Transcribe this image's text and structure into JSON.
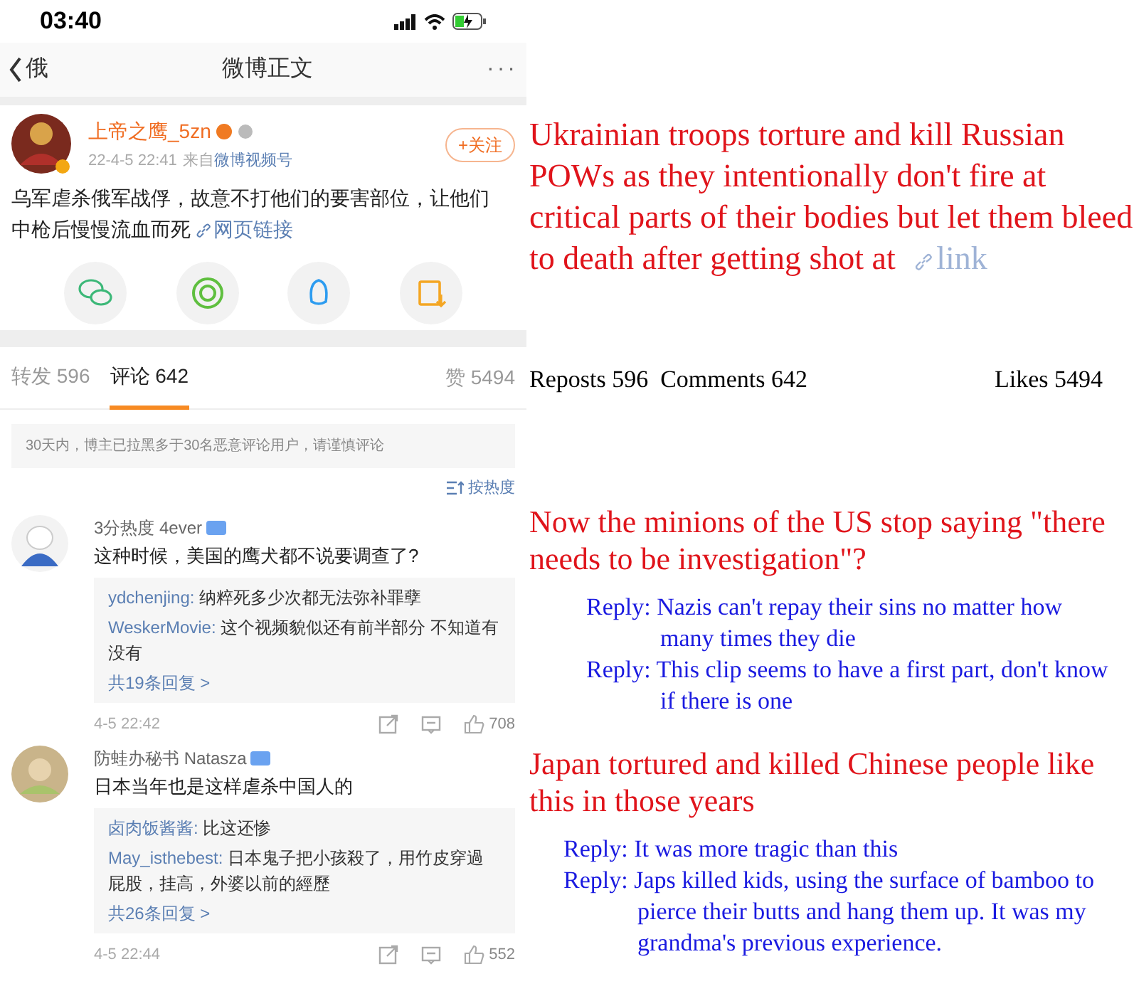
{
  "status_bar": {
    "time": "03:40"
  },
  "nav": {
    "back_label": "俄",
    "title": "微博正文",
    "more": "···"
  },
  "post": {
    "author": "上帝之鹰_5zn",
    "time": "22-4-5 22:41",
    "source_prefix": "来自",
    "source": "微博视频号",
    "follow": "+关注",
    "text": "乌军虐杀俄军战俘，故意不打他们的要害部位，让他们中枪后慢慢流血而死",
    "link": "网页链接"
  },
  "share_buttons": [
    {
      "kind": "wechat"
    },
    {
      "kind": "moments"
    },
    {
      "kind": "qq"
    },
    {
      "kind": "save_image"
    }
  ],
  "tabs": [
    {
      "label": "转发 596",
      "selected": false
    },
    {
      "label": "评论 642",
      "selected": true
    }
  ],
  "likes": "赞 5494",
  "notice": "30天内，博主已拉黑多于30名恶意评论用户，请谨慎评论",
  "sort": "按热度",
  "comments": [
    {
      "author": "3分热度 4ever",
      "text": "这种时候，美国的鹰犬都不说要调查了?",
      "replies": [
        {
          "author": "ydchenjing:",
          "text": "纳粹死多少次都无法弥补罪孽"
        },
        {
          "author": "WeskerMovie:",
          "text": "这个视频貌似还有前半部分 不知道有没有"
        }
      ],
      "more_replies": "共19条回复 >",
      "time": "4-5 22:42",
      "likes": "708"
    },
    {
      "author": "防蛙办秘书 Natasza",
      "text": "日本当年也是这样虐杀中国人的",
      "replies": [
        {
          "author": "卤肉饭酱酱:",
          "text": "比这还惨"
        },
        {
          "author": "May_isthebest:",
          "text": "日本鬼子把小孩殺了，用竹皮穿過屁股，挂高，外婆以前的經歷"
        }
      ],
      "more_replies": "共26条回复 >",
      "time": "4-5 22:44",
      "likes": "552"
    }
  ],
  "translation": {
    "post_text": "Ukrainian troops torture and kill Russian POWs as they intentionally don't fire at critical parts of their bodies but let them bleed to death after getting shot at",
    "link": "link",
    "stats": "Reposts 596  Comments 642",
    "likes": "Likes 5494",
    "comments": [
      {
        "text": "Now the minions of the US stop saying \"there needs to be investigation\"?",
        "replies": [
          "Reply: Nazis can't repay their sins no matter how many times they die",
          "Reply: This clip seems to have a first part, don't know if there is one"
        ]
      },
      {
        "text": "Japan tortured and killed Chinese people like this in those years",
        "replies": [
          "Reply: It was more tragic than this",
          "Reply: Japs killed kids, using the surface of bamboo to pierce their butts and hang them up. It was my grandma's previous experience."
        ]
      }
    ]
  }
}
